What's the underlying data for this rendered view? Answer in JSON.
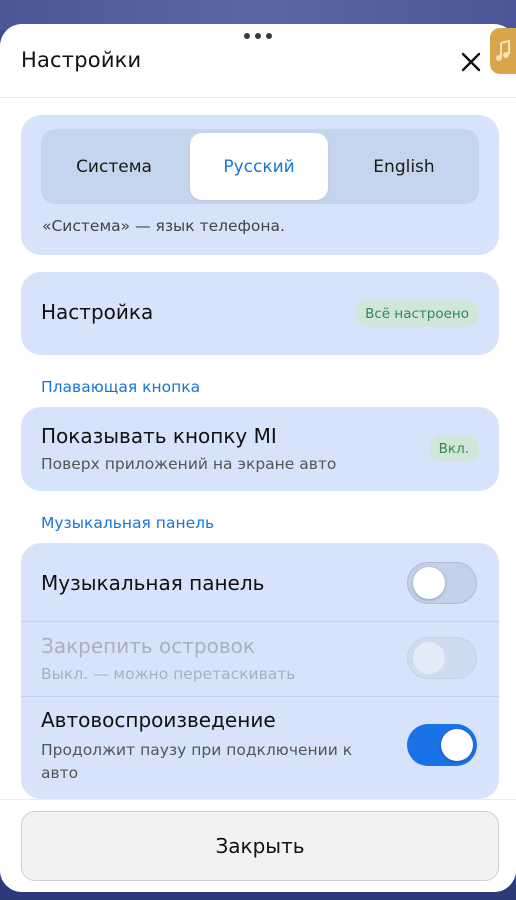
{
  "header": {
    "title": "Настройки",
    "close_icon": "close-icon"
  },
  "language": {
    "options": [
      "Система",
      "Русский",
      "English"
    ],
    "selected": "Русский",
    "note": "«Система» — язык телефона."
  },
  "setup": {
    "label": "Настройка",
    "status": "Всё настроено"
  },
  "floating_button": {
    "section": "Плавающая кнопка",
    "title": "Показывать кнопку MI",
    "subtitle": "Поверх приложений на экране авто",
    "status": "Вкл."
  },
  "music_panel": {
    "section": "Музыкальная панель",
    "items": [
      {
        "title": "Музыкальная панель",
        "subtitle": "",
        "on": false,
        "enabled": true
      },
      {
        "title": "Закрепить островок",
        "subtitle": "Выкл. — можно перетаскивать",
        "on": false,
        "enabled": false
      },
      {
        "title": "Автовоспроизведение",
        "subtitle": "Продолжит паузу при подключении к авто",
        "on": true,
        "enabled": true
      }
    ]
  },
  "footer": {
    "close_label": "Закрыть"
  },
  "colors": {
    "accent": "#1676d8",
    "card_bg": "#d6e3fb",
    "toggle_on": "#1a72e8",
    "badge_green": "#2e8a55"
  }
}
